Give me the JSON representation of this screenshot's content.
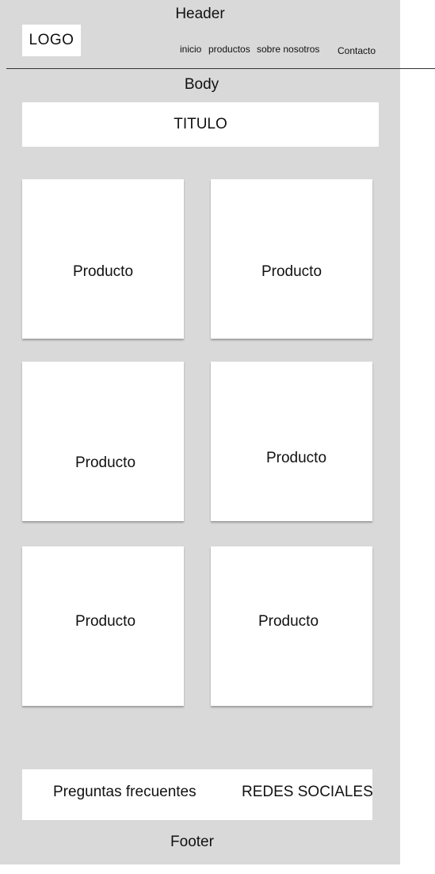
{
  "header": {
    "label": "Header",
    "logo": "LOGO",
    "nav": {
      "inicio": "inicio",
      "productos": "productos",
      "sobre_nosotros": "sobre nosotros",
      "contacto": "Contacto"
    }
  },
  "body": {
    "label": "Body",
    "title": "TITULO",
    "products": [
      "Producto",
      "Producto",
      "Producto",
      "Producto",
      "Producto",
      "Producto"
    ]
  },
  "footer": {
    "faq": "Preguntas frecuentes",
    "social": "REDES SOCIALES",
    "label": "Footer"
  },
  "colors": {
    "frame_background": "#d9d9d9",
    "box_background": "#ffffff",
    "text": "#111111"
  }
}
